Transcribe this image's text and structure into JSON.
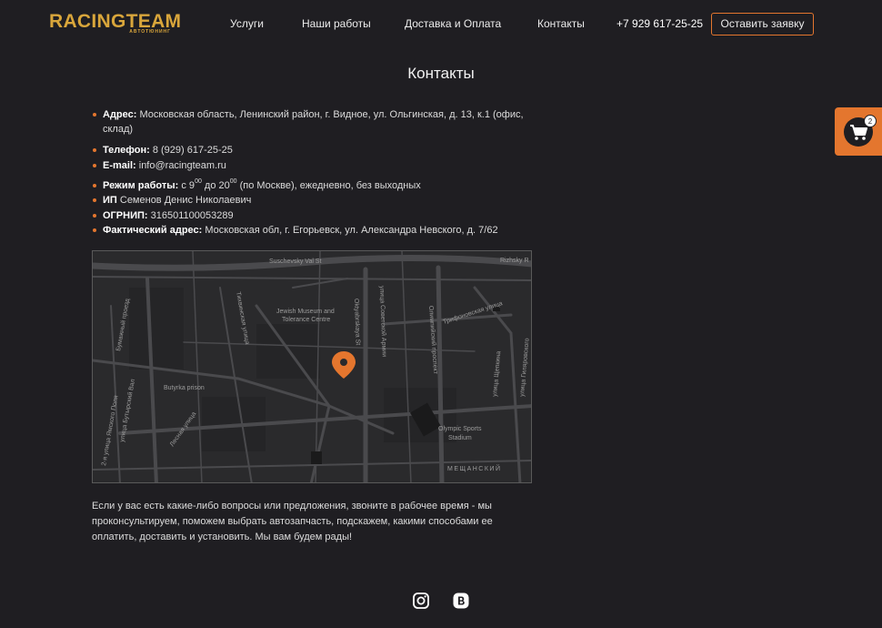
{
  "header": {
    "logo_text": "RACINGTEAM",
    "logo_sub": "АВТОТЮНИНГ",
    "nav": [
      {
        "label": "Услуги"
      },
      {
        "label": "Наши работы"
      },
      {
        "label": "Доставка и Оплата"
      },
      {
        "label": "Контакты"
      }
    ],
    "phone": "+7 929 617-25-25",
    "cta_label": "Оставить заявку"
  },
  "page_title": "Контакты",
  "contacts": {
    "address_label": "Адрес:",
    "address_value": "Московская область, Ленинский район, г. Видное, ул. Ольгинская, д. 13, к.1 (офис, склад)",
    "phone_label": "Телефон:",
    "phone_value": "8 (929) 617-25-25",
    "email_label": "E-mail:",
    "email_value": "info@racingteam.ru",
    "hours_label": "Режим работы:",
    "hours_prefix": "с 9",
    "hours_sup1": "00",
    "hours_middle": " до 20",
    "hours_sup2": "00",
    "hours_suffix": " (по Москве), ежедневно, без выходных",
    "ip_label": "ИП",
    "ip_value": "Семенов Денис Николаевич",
    "ogrnip_label": "ОГРНИП:",
    "ogrnip_value": "316501100053289",
    "actual_label": "Фактический адрес:",
    "actual_value": "Московская обл, г. Егорьевск, ул. Александра Невского, д. 7/62"
  },
  "map": {
    "labels": {
      "sushchevsky": "Suschevsky Val St",
      "rizhsky": "Rizhsky R",
      "jewish1": "Jewish Museum and",
      "jewish2": "Tolerance Centre",
      "tikhvinskaya": "Тихвинская улица",
      "oktyabrskaya": "Oktyabrskaya St",
      "sovetskoy": "улица Советской Армии",
      "olimpiyskiy": "Олимпийский проспект",
      "trifonovskaya": "Трифоновская улица",
      "butyrka": "Butyrka prison",
      "lesnaya": "Лесная улица",
      "olympic1": "Olympic Sports",
      "olympic2": "Stadium",
      "meshchansky": "МЕЩАНСКИЙ",
      "bumazhny": "Бумажный проезд",
      "butyrsky_val": "улица Бутырский Вал",
      "yamskogo": "2-я улица Ямского Поля",
      "shchepkina": "улица Щепкина",
      "gilyarovskogo": "улица Гиляровского"
    },
    "marker_color": "#e4762e"
  },
  "description": "Если у вас есть какие-либо вопросы или предложения, звоните в рабочее время - мы проконсультируем, поможем выбрать автозапчасть, подскажем, какими способами ее оплатить, доставить и установить. Мы вам будем рады!",
  "cart": {
    "count": "2",
    "icon": "cart-icon"
  },
  "social": [
    {
      "icon": "instagram-icon"
    },
    {
      "icon": "vk-icon"
    }
  ],
  "colors": {
    "accent": "#e4762e",
    "background": "#1f1e22",
    "logo": "#d9a63b"
  }
}
